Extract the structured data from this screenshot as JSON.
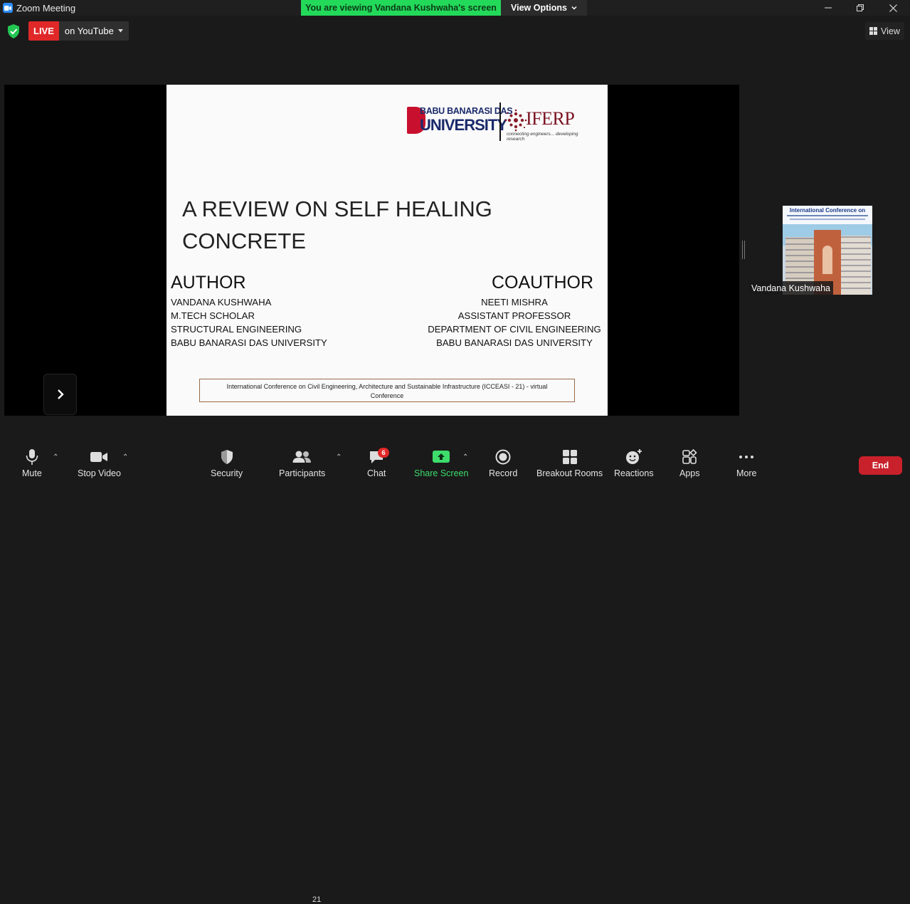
{
  "window": {
    "title": "Zoom Meeting",
    "viewing_banner": "You are viewing Vandana Kushwaha's screen",
    "view_options_label": "View Options",
    "controls": [
      "minimize",
      "restore",
      "close"
    ]
  },
  "top_bar": {
    "live_label": "LIVE",
    "live_destination": "on YouTube",
    "view_label": "View"
  },
  "slide": {
    "logo_left_top": "BABU BANARASI DAS",
    "logo_left_bottom": "UNIVERSITY",
    "logo_right": "IFERP",
    "logo_right_tagline": "connecting engineers... developing research",
    "title_line1": "A REVIEW ON SELF HEALING",
    "title_line2": "CONCRETE",
    "author": {
      "heading": "AUTHOR",
      "lines": [
        "VANDANA KUSHWAHA",
        "M.TECH SCHOLAR",
        "STRUCTURAL ENGINEERING",
        "BABU BANARASI DAS UNIVERSITY"
      ]
    },
    "coauthor": {
      "heading": "COAUTHOR",
      "lines": [
        "NEETI MISHRA",
        "ASSISTANT PROFESSOR",
        "DEPARTMENT OF CIVIL ENGINEERING",
        "BABU BANARASI DAS UNIVERSITY"
      ]
    },
    "conference": "International Conference on Civil Engineering, Architecture and Sustainable Infrastructure (ICCEASI - 21) - virtual Conference"
  },
  "participant_video": {
    "name": "Vandana Kushwaha",
    "banner_title": "International Conference on"
  },
  "toolbar": {
    "mute": "Mute",
    "stop_video": "Stop Video",
    "security": "Security",
    "participants": "Participants",
    "participants_count": "21",
    "chat": "Chat",
    "chat_badge": "6",
    "share_screen": "Share Screen",
    "record": "Record",
    "breakout_rooms": "Breakout Rooms",
    "reactions": "Reactions",
    "apps": "Apps",
    "more": "More",
    "end": "End"
  },
  "colors": {
    "banner_green": "#23d959",
    "live_red": "#e02828",
    "end_red": "#c8212b",
    "share_green": "#3ddc6b",
    "zoom_blue": "#2d8cff"
  }
}
